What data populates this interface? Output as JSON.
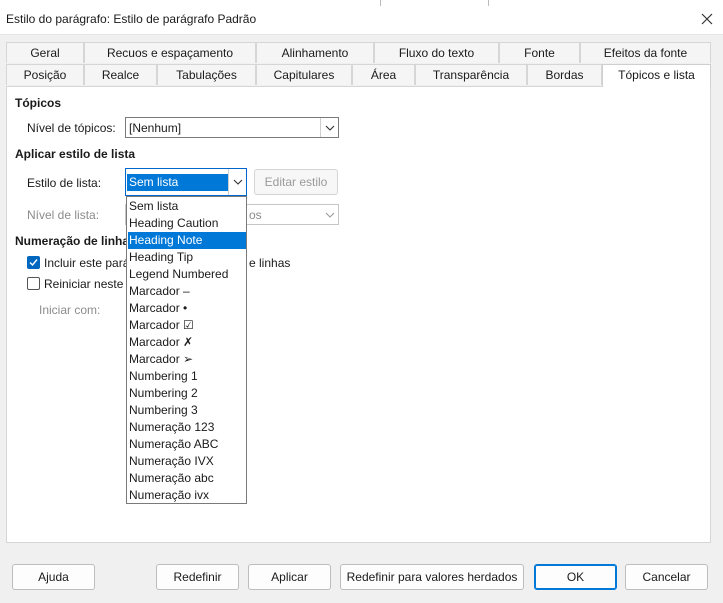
{
  "window": {
    "title": "Estilo do parágrafo: Estilo de parágrafo Padrão"
  },
  "tabs_row1": [
    "Geral",
    "Recuos e espaçamento",
    "Alinhamento",
    "Fluxo do texto",
    "Fonte",
    "Efeitos da fonte"
  ],
  "tabs_row2": [
    "Posição",
    "Realce",
    "Tabulações",
    "Capitulares",
    "Área",
    "Transparência",
    "Bordas",
    "Tópicos e lista"
  ],
  "topicos": {
    "heading": "Tópicos",
    "level_label": "Nível de tópicos:",
    "level_value": "[Nenhum]"
  },
  "list_style": {
    "heading": "Aplicar estilo de lista",
    "style_label": "Estilo de lista:",
    "style_value": "Sem lista",
    "edit_button": "Editar estilo",
    "level_label": "Nível de lista:",
    "level_value_tail": "os"
  },
  "numbering": {
    "heading": "Numeração de linhas",
    "include_label": "Incluir este pará",
    "include_tail": "e linhas",
    "include_checked": true,
    "restart_label": "Reiniciar neste p",
    "restart_checked": false,
    "start_label": "Iniciar com:"
  },
  "dropdown": {
    "items": [
      "Sem lista",
      "Heading Caution",
      "Heading Note",
      "Heading Tip",
      "Legend Numbered",
      "Marcador –",
      "Marcador •",
      "Marcador ☑",
      "Marcador ✗",
      "Marcador ➢",
      "Numbering 1",
      "Numbering 2",
      "Numbering 3",
      "Numeração 123",
      "Numeração ABC",
      "Numeração IVX",
      "Numeração abc",
      "Numeração ivx"
    ],
    "highlighted": "Heading Note"
  },
  "buttons": {
    "help": "Ajuda",
    "reset": "Redefinir",
    "apply": "Aplicar",
    "reset_inherited": "Redefinir para valores herdados",
    "ok": "OK",
    "cancel": "Cancelar"
  },
  "colors": {
    "accent": "#0078d7",
    "background": "#f0f0f0"
  }
}
